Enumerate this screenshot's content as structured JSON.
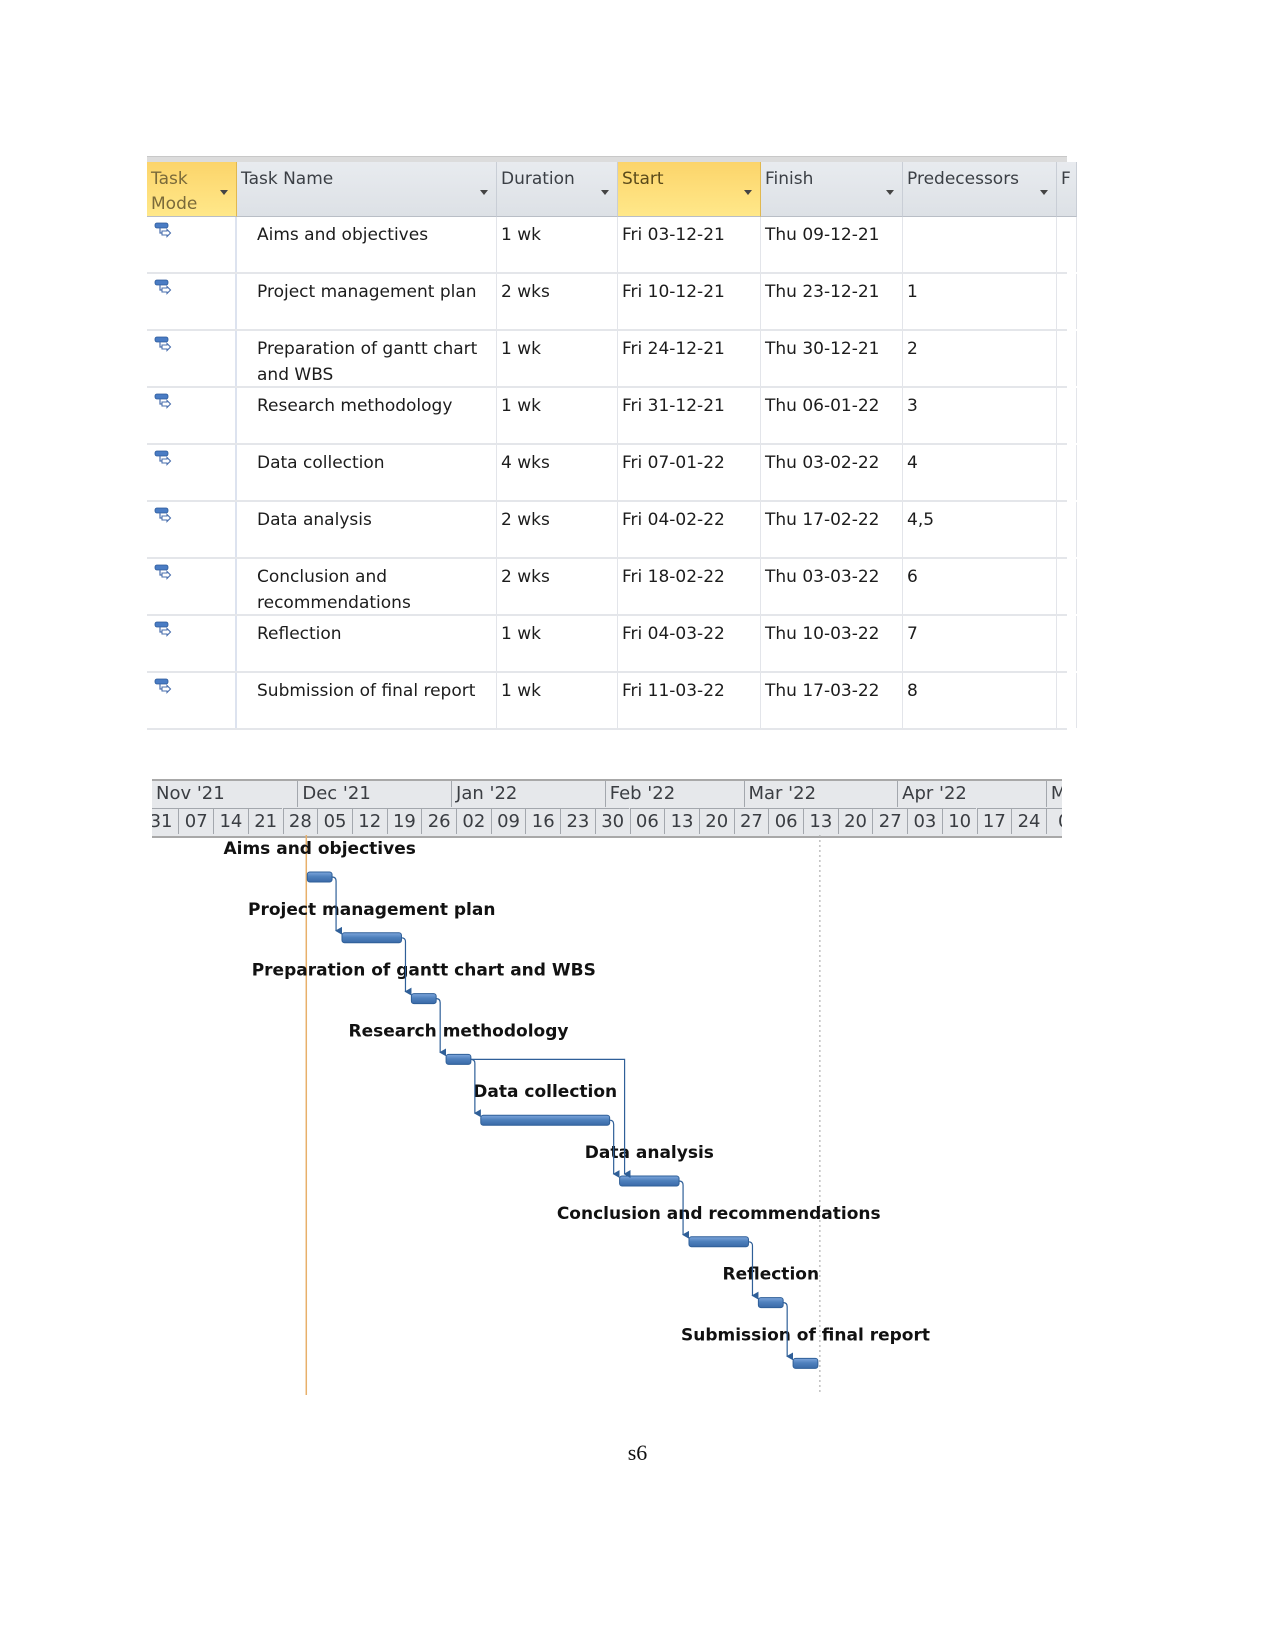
{
  "table": {
    "columns": [
      {
        "key": "mode",
        "label": "Task Mode",
        "selected": true
      },
      {
        "key": "name",
        "label": "Task Name",
        "selected": false
      },
      {
        "key": "duration",
        "label": "Duration",
        "selected": false
      },
      {
        "key": "start",
        "label": "Start",
        "selected": true
      },
      {
        "key": "finish",
        "label": "Finish",
        "selected": false
      },
      {
        "key": "pred",
        "label": "Predecessors",
        "selected": false
      },
      {
        "key": "next",
        "label": "F",
        "selected": false
      }
    ],
    "mode_icon": "auto-scheduled-task-icon",
    "rows": [
      {
        "name": "Aims and objectives",
        "duration": "1 wk",
        "start": "Fri 03-12-21",
        "finish": "Thu 09-12-21",
        "pred": ""
      },
      {
        "name": "Project management plan",
        "duration": "2 wks",
        "start": "Fri 10-12-21",
        "finish": "Thu 23-12-21",
        "pred": "1"
      },
      {
        "name": "Preparation of gantt chart and WBS",
        "duration": "1 wk",
        "start": "Fri 24-12-21",
        "finish": "Thu 30-12-21",
        "pred": "2"
      },
      {
        "name": "Research methodology",
        "duration": "1 wk",
        "start": "Fri 31-12-21",
        "finish": "Thu 06-01-22",
        "pred": "3"
      },
      {
        "name": "Data collection",
        "duration": "4 wks",
        "start": "Fri 07-01-22",
        "finish": "Thu 03-02-22",
        "pred": "4"
      },
      {
        "name": "Data analysis",
        "duration": "2 wks",
        "start": "Fri 04-02-22",
        "finish": "Thu 17-02-22",
        "pred": "4,5"
      },
      {
        "name": "Conclusion and recommendations",
        "duration": "2 wks",
        "start": "Fri 18-02-22",
        "finish": "Thu 03-03-22",
        "pred": "6"
      },
      {
        "name": "Reflection",
        "duration": "1 wk",
        "start": "Fri 04-03-22",
        "finish": "Thu 10-03-22",
        "pred": "7"
      },
      {
        "name": "Submission of final report",
        "duration": "1 wk",
        "start": "Fri 11-03-22",
        "finish": "Thu 17-03-22",
        "pred": "8"
      }
    ]
  },
  "chart_data": {
    "type": "gantt",
    "title": "",
    "timescale": {
      "months": [
        "Nov '21",
        "Dec '21",
        "Jan '22",
        "Feb '22",
        "Mar '22",
        "Apr '22",
        "M"
      ],
      "weeks": [
        "31",
        "07",
        "14",
        "21",
        "28",
        "05",
        "12",
        "19",
        "26",
        "02",
        "09",
        "16",
        "23",
        "30",
        "06",
        "13",
        "20",
        "27",
        "06",
        "13",
        "20",
        "27",
        "03",
        "10",
        "17",
        "24",
        "0"
      ],
      "first_full_week_start": "2021-11-07",
      "visible_start": "2021-10-31",
      "visible_end": "2022-05-01"
    },
    "tasks": [
      {
        "id": 1,
        "name": "Aims and objectives",
        "start": "2021-12-03",
        "finish": "2021-12-09",
        "predecessors": []
      },
      {
        "id": 2,
        "name": "Project management plan",
        "start": "2021-12-10",
        "finish": "2021-12-23",
        "predecessors": [
          1
        ]
      },
      {
        "id": 3,
        "name": "Preparation of gantt chart and WBS",
        "start": "2021-12-24",
        "finish": "2021-12-30",
        "predecessors": [
          2
        ]
      },
      {
        "id": 4,
        "name": "Research methodology",
        "start": "2021-12-31",
        "finish": "2022-01-06",
        "predecessors": [
          3
        ]
      },
      {
        "id": 5,
        "name": "Data collection",
        "start": "2022-01-07",
        "finish": "2022-02-03",
        "predecessors": [
          4
        ]
      },
      {
        "id": 6,
        "name": "Data analysis",
        "start": "2022-02-04",
        "finish": "2022-02-17",
        "predecessors": [
          4,
          5
        ]
      },
      {
        "id": 7,
        "name": "Conclusion and recommendations",
        "start": "2022-02-18",
        "finish": "2022-03-03",
        "predecessors": [
          6
        ]
      },
      {
        "id": 8,
        "name": "Reflection",
        "start": "2022-03-04",
        "finish": "2022-03-10",
        "predecessors": [
          7
        ]
      },
      {
        "id": 9,
        "name": "Submission of final report",
        "start": "2022-03-11",
        "finish": "2022-03-17",
        "predecessors": [
          8
        ]
      }
    ],
    "markers": [
      {
        "type": "project-start",
        "date": "2021-12-03",
        "color": "#e8b06a"
      },
      {
        "type": "status-date",
        "date": "2022-03-16",
        "style": "dotted",
        "color": "#b0b0b0"
      }
    ],
    "bar_color": "#4f81bd",
    "link_color": "#2f5f98"
  },
  "footer": {
    "page_number": "s6"
  }
}
